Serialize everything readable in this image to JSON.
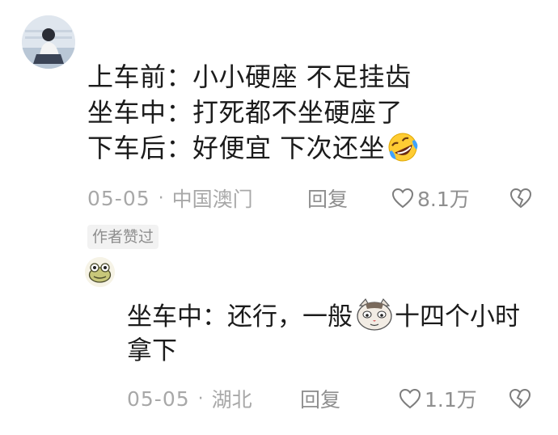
{
  "main_comment": {
    "lines": [
      "上车前：小小硬座 不足挂齿",
      "坐车中：打死都不坐硬座了",
      "下车后：好便宜 下次还坐"
    ],
    "emoji": "rofl-emoji",
    "date": "05-05",
    "location": "中国澳门",
    "reply_label": "回复",
    "likes": "8.1万"
  },
  "author_badge": "作者赞过",
  "reply_comment": {
    "line1_before": "坐车中：还行，一般",
    "line1_after": "十四个小时",
    "line2": "拿下",
    "emoji": "cat-face-emoji",
    "date": "05-05",
    "location": "湖北",
    "reply_label": "回复",
    "likes": "1.1万"
  },
  "colors": {
    "text": "#1b1b1b",
    "meta": "#a8a8a8",
    "badge_bg": "#f2f2f2"
  }
}
